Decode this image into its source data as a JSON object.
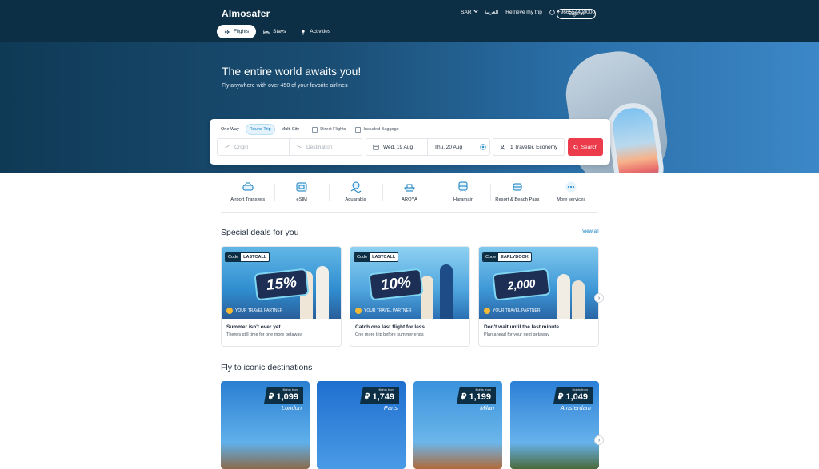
{
  "header": {
    "logo": "Almosafer",
    "currency": "SAR",
    "language": "العربية",
    "retrieve_trip": "Retrieve my trip",
    "phone": "+966554400000",
    "sign_in": "Sign in",
    "tabs": [
      {
        "label": "Flights",
        "icon": "plane-icon"
      },
      {
        "label": "Stays",
        "icon": "bed-icon"
      },
      {
        "label": "Activities",
        "icon": "pin-icon"
      }
    ]
  },
  "hero": {
    "title": "The entire world awaits you!",
    "subtitle": "Fly anywhere with over 450 of your favorite airlines"
  },
  "search": {
    "trip_types": [
      "One Way",
      "Round Trip",
      "Multi City"
    ],
    "active_trip_type": "Round Trip",
    "direct_flights": "Direct Flights",
    "included_baggage": "Included Baggage",
    "origin_placeholder": "Origin",
    "destination_placeholder": "Destination",
    "depart_date": "Wed, 19 Aug",
    "return_date": "Thu, 20 Aug",
    "travelers": "1 Traveler, Economy",
    "search_label": "Search"
  },
  "services": [
    {
      "label": "Airport Transfers",
      "icon": "car-icon"
    },
    {
      "label": "eSIM",
      "icon": "sim-icon"
    },
    {
      "label": "Aquarabia",
      "icon": "waterpark-icon"
    },
    {
      "label": "AROYA",
      "icon": "cruise-icon"
    },
    {
      "label": "Haramain",
      "icon": "train-icon"
    },
    {
      "label": "Resort & Beach Pass",
      "icon": "resort-icon"
    },
    {
      "label": "More services",
      "icon": "more-icon"
    }
  ],
  "deals": {
    "title": "Special deals for you",
    "view_all": "View all",
    "items": [
      {
        "code_label": "Code",
        "code": "LASTCALL",
        "badge": "15%",
        "title": "Summer isn't over yet",
        "subtitle": "There's still time for one more getaway",
        "partner": "YOUR TRAVEL PARTNER"
      },
      {
        "code_label": "Code",
        "code": "LASTCALL",
        "badge": "10%",
        "title": "Catch one last flight for less",
        "subtitle": "One more trip before summer ends",
        "partner": "YOUR TRAVEL PARTNER"
      },
      {
        "code_label": "Code",
        "code": "EARLYBOOK",
        "badge": "2,000",
        "title": "Don't wait until the last minute",
        "subtitle": "Plan ahead for your next getaway",
        "partner": "YOUR TRAVEL PARTNER"
      }
    ]
  },
  "destinations": {
    "title": "Fly to iconic destinations",
    "from_label": "flights from",
    "items": [
      {
        "city": "London",
        "price": "⃁ 1,099"
      },
      {
        "city": "Paris",
        "price": "⃁ 1,749"
      },
      {
        "city": "Milan",
        "price": "⃁ 1,199"
      },
      {
        "city": "Amsterdam",
        "price": "⃁ 1,049"
      }
    ]
  },
  "colors": {
    "header": "#0d2f45",
    "accent": "#0f7dc2",
    "search_button": "#ec3b4a"
  }
}
